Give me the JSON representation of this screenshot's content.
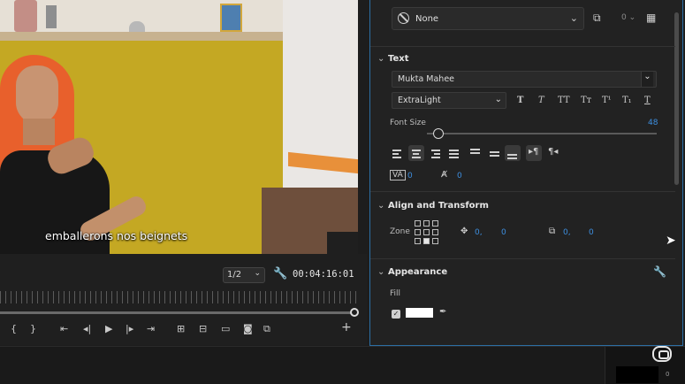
{
  "video": {
    "subtitle": "emballerons nos beignets"
  },
  "monitor": {
    "resolution": "1/2",
    "timecode": "00:04:16:01",
    "transport_icons": [
      "mark-in-icon",
      "mark-out-icon",
      "go-to-in-icon",
      "step-back-icon",
      "play-icon",
      "step-forward-icon",
      "go-to-out-icon",
      "lift-icon",
      "extract-icon",
      "safe-margins-icon",
      "export-frame-icon",
      "compare-icon",
      "add-button-icon"
    ]
  },
  "panel": {
    "style_preset": "None",
    "style_count": "0",
    "text_section": {
      "title": "Text",
      "font_family": "Mukta Mahee",
      "font_weight": "ExtraLight",
      "style_buttons": [
        "T",
        "T",
        "TT",
        "Tт",
        "T¹",
        "T₁",
        "T"
      ],
      "font_size_label": "Font Size",
      "font_size_value": "48",
      "font_size_fraction": 0.05,
      "tracking_value": "0",
      "leading_value": "0"
    },
    "align_section": {
      "title": "Align and Transform",
      "zone_label": "Zone",
      "position_x": "0,",
      "position_y": "0",
      "scale_x": "0,",
      "scale_y": "0"
    },
    "appearance_section": {
      "title": "Appearance",
      "fill_label": "Fill",
      "fill_color": "#ffffff"
    }
  },
  "bottom": {
    "meter_value": "0"
  },
  "colors": {
    "accent_blue": "#3d8fe0",
    "panel_border": "#2d6fa5",
    "background": "#1d1d1d"
  }
}
